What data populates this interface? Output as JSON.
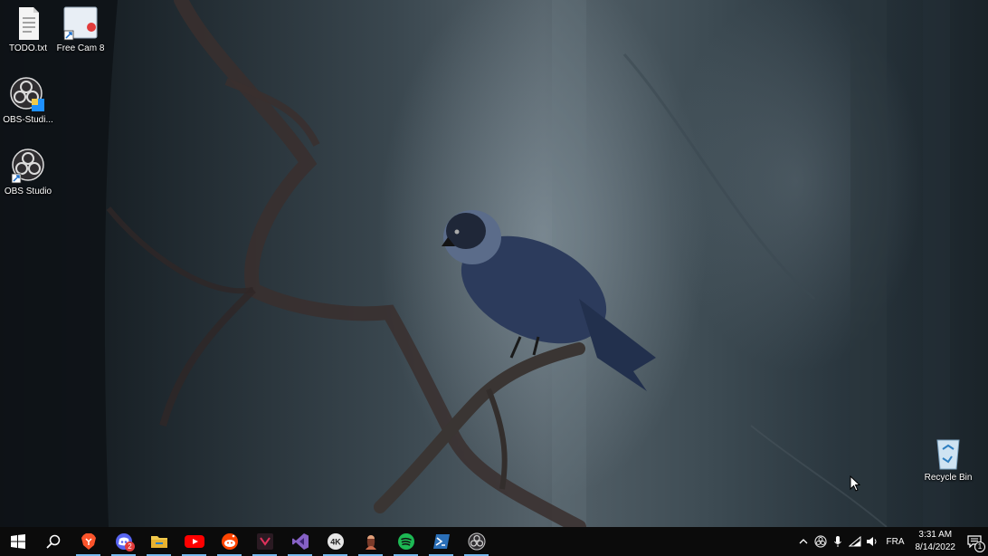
{
  "desktop": {
    "icons": [
      {
        "label": "TODO.txt",
        "icon": "text-file-icon"
      },
      {
        "label": "Free Cam 8",
        "icon": "free-cam-icon"
      },
      {
        "label": "OBS-Studi...",
        "icon": "obs-installer-icon"
      },
      {
        "label": "OBS Studio",
        "icon": "obs-studio-icon"
      },
      {
        "label": "Recycle Bin",
        "icon": "recycle-bin-icon"
      }
    ],
    "wallpaper": "jackdaw perched on a branch in a misty forest"
  },
  "taskbar": {
    "pinned": [
      {
        "name": "start",
        "icon": "windows-logo-icon"
      },
      {
        "name": "search",
        "icon": "search-icon"
      },
      {
        "name": "brave",
        "icon": "brave-icon"
      },
      {
        "name": "discord",
        "icon": "discord-icon",
        "badge": "2"
      },
      {
        "name": "file-explorer",
        "icon": "folder-icon"
      },
      {
        "name": "youtube",
        "icon": "youtube-icon"
      },
      {
        "name": "reddit",
        "icon": "reddit-icon"
      },
      {
        "name": "davinci",
        "icon": "resolve-icon"
      },
      {
        "name": "visual-studio",
        "icon": "visual-studio-icon"
      },
      {
        "name": "4k-downloader",
        "icon": "4k-icon"
      },
      {
        "name": "app-portrait",
        "icon": "portrait-app-icon"
      },
      {
        "name": "spotify",
        "icon": "spotify-icon"
      },
      {
        "name": "powershell",
        "icon": "powershell-icon"
      },
      {
        "name": "obs",
        "icon": "obs-icon"
      }
    ],
    "tray": {
      "language": "FRA",
      "time": "3:31 AM",
      "date": "8/14/2022",
      "notification_count": "1"
    }
  },
  "colors": {
    "taskbar": "#0b0b0b",
    "running_indicator": "#76b9ed"
  }
}
